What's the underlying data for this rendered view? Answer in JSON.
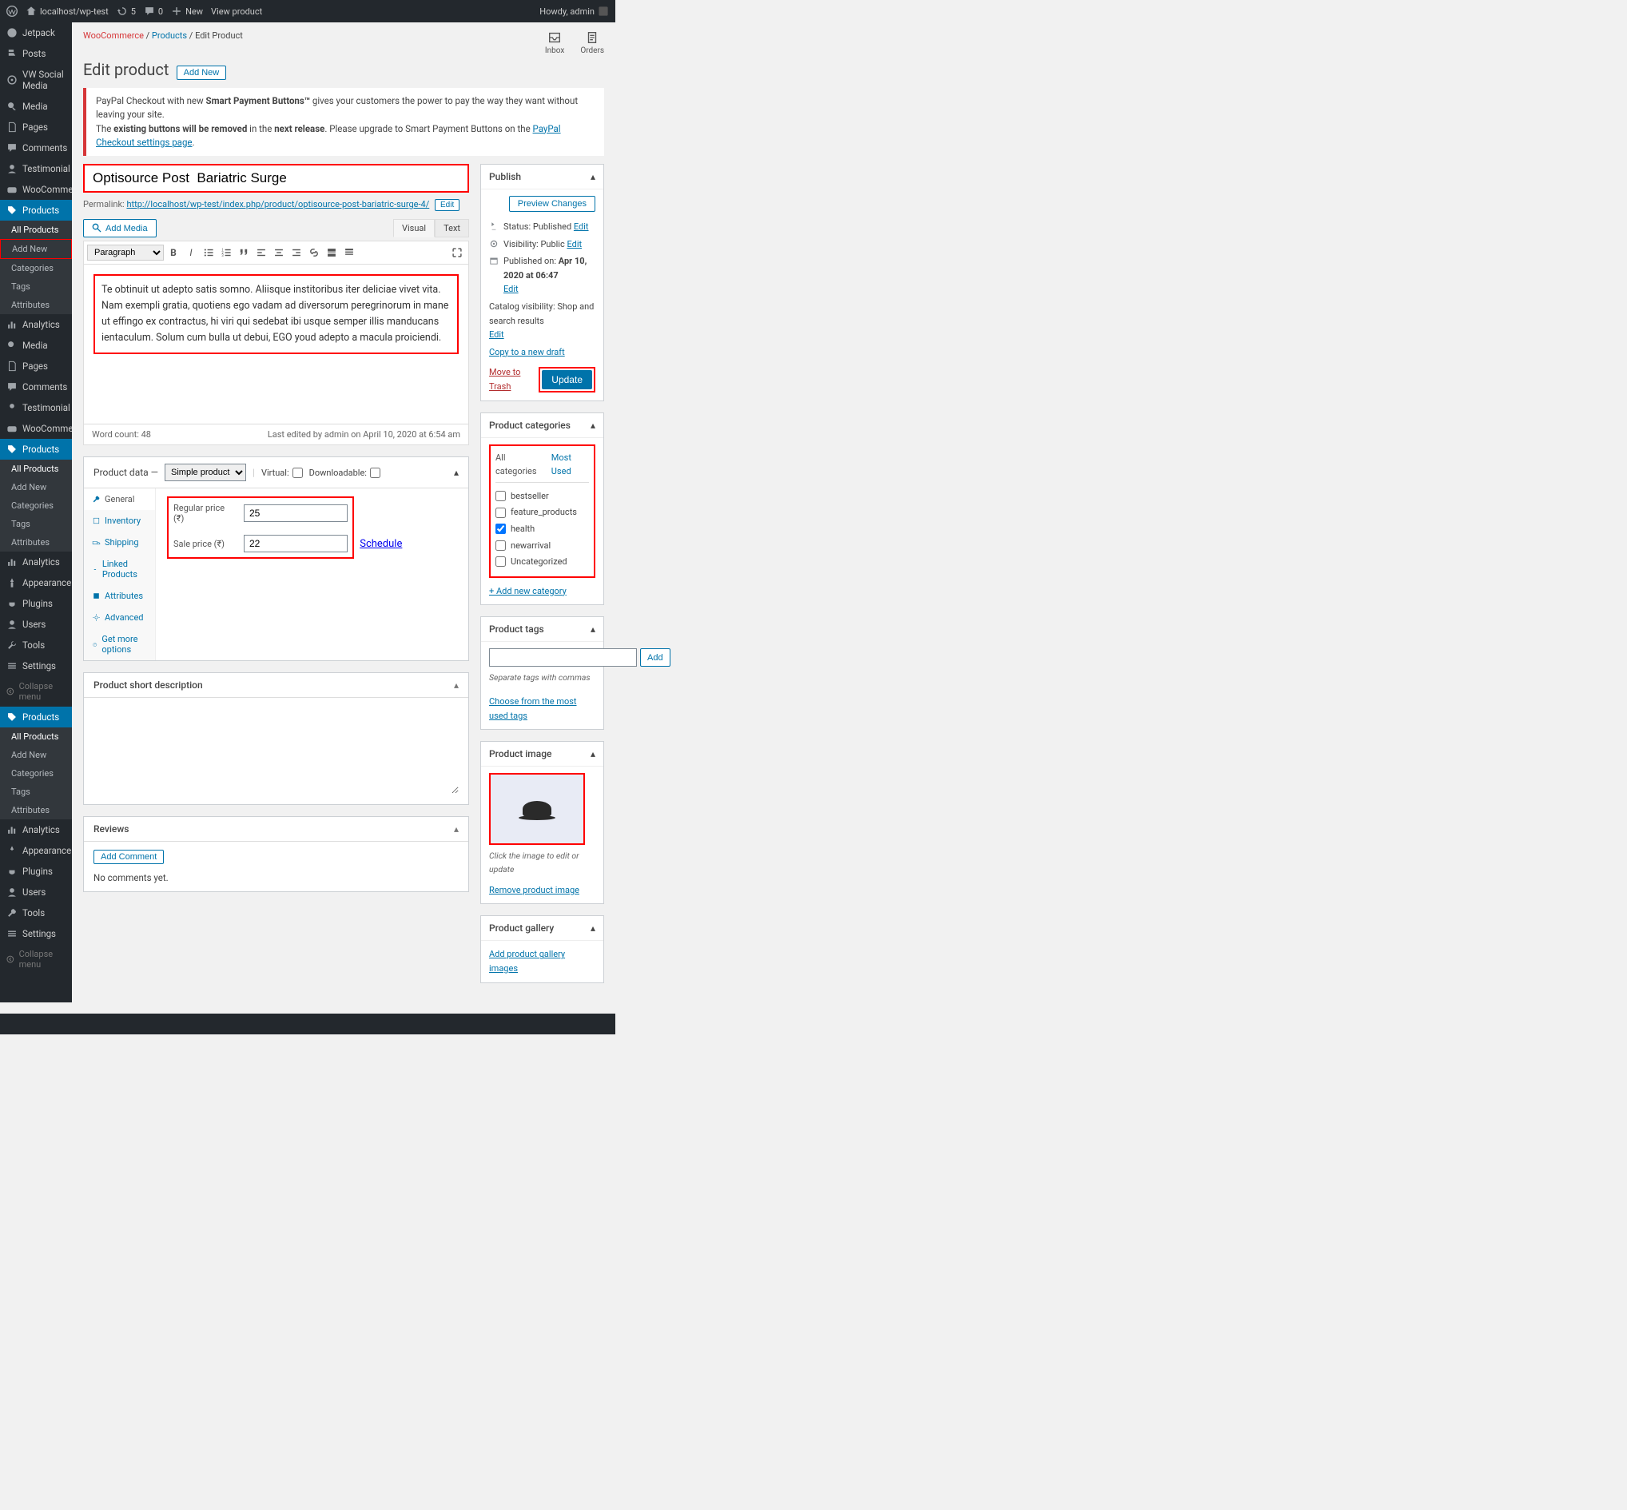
{
  "adminbar": {
    "site": "localhost/wp-test",
    "updates": "5",
    "comments": "0",
    "new": "New",
    "view": "View product",
    "howdy": "Howdy, admin"
  },
  "sidebar": {
    "items": [
      "Jetpack",
      "Posts",
      "VW Social Media",
      "Media",
      "Pages",
      "Comments",
      "Testimonial",
      "WooCommerce",
      "Products",
      "Analytics",
      "Media",
      "Pages",
      "Comments",
      "Testimonial",
      "WooCommerce",
      "Products",
      "Analytics",
      "Appearance",
      "Plugins",
      "Users",
      "Tools",
      "Settings",
      "Products",
      "Analytics",
      "Appearance",
      "Plugins",
      "Users",
      "Tools",
      "Settings"
    ],
    "submenu1": [
      "All Products",
      "Add New",
      "Categories",
      "Tags",
      "Attributes"
    ],
    "collapse": "Collapse menu"
  },
  "breadcrumb": {
    "wc": "WooCommerce",
    "products": "Products",
    "edit": "Edit Product",
    "inbox": "Inbox",
    "orders": "Orders"
  },
  "page": {
    "title": "Edit product",
    "addnew": "Add New"
  },
  "notice": {
    "p1a": "PayPal Checkout with new ",
    "p1b": "Smart Payment Buttons™",
    "p1c": " gives your customers the power to pay the way they want without leaving your site.",
    "p2a": "The ",
    "p2b": "existing buttons will be removed",
    "p2c": " in the ",
    "p2d": "next release",
    "p2e": ". Please upgrade to Smart Payment Buttons on the ",
    "p2link": "PayPal Checkout settings page",
    "p2f": "."
  },
  "product": {
    "title": "Optisource Post  Bariatric Surge",
    "permalink_label": "Permalink: ",
    "permalink_base": "http://localhost/wp-test/index.php/product/",
    "permalink_slug": "optisource-post-bariatric-surge-4/",
    "edit": "Edit"
  },
  "editor": {
    "addmedia": "Add Media",
    "visual": "Visual",
    "text": "Text",
    "paragraph": "Paragraph",
    "body": "Te obtinuit ut adepto satis somno. Aliisque institoribus iter deliciae vivet vita. Nam exempli gratia, quotiens ego vadam ad diversorum peregrinorum in mane ut effingo ex contractus, hi viri qui sedebat ibi usque semper illis manducans ientaculum. Solum cum bulla ut debui, EGO youd adepto a macula proiciendi.",
    "wordcount": "Word count: 48",
    "lastedit": "Last edited by admin on April 10, 2020 at 6:54 am"
  },
  "productdata": {
    "header": "Product data —",
    "type": "Simple product",
    "virtual": "Virtual:",
    "downloadable": "Downloadable:",
    "tabs": [
      "General",
      "Inventory",
      "Shipping",
      "Linked Products",
      "Attributes",
      "Advanced",
      "Get more options"
    ],
    "regular_lbl": "Regular price (₹)",
    "regular_val": "25",
    "sale_lbl": "Sale price (₹)",
    "sale_val": "22",
    "schedule": "Schedule"
  },
  "shortdesc": {
    "title": "Product short description"
  },
  "reviews": {
    "title": "Reviews",
    "add": "Add Comment",
    "none": "No comments yet."
  },
  "publish": {
    "title": "Publish",
    "preview": "Preview Changes",
    "status_lbl": "Status:",
    "status_val": "Published",
    "edit": "Edit",
    "vis_lbl": "Visibility:",
    "vis_val": "Public",
    "pub_lbl": "Published on:",
    "pub_val": "Apr 10, 2020 at 06:47",
    "catvis_lbl": "Catalog visibility:",
    "catvis_val": "Shop and search results",
    "copy": "Copy to a new draft",
    "trash": "Move to Trash",
    "update": "Update"
  },
  "categories": {
    "title": "Product categories",
    "tab1": "All categories",
    "tab2": "Most Used",
    "items": [
      "bestseller",
      "feature_products",
      "health",
      "newarrival",
      "Uncategorized"
    ],
    "checked": "health",
    "addnew": "+ Add new category"
  },
  "tags": {
    "title": "Product tags",
    "add": "Add",
    "hint": "Separate tags with commas",
    "choose": "Choose from the most used tags"
  },
  "image": {
    "title": "Product image",
    "hint": "Click the image to edit or update",
    "remove": "Remove product image"
  },
  "gallery": {
    "title": "Product gallery",
    "add": "Add product gallery images"
  }
}
